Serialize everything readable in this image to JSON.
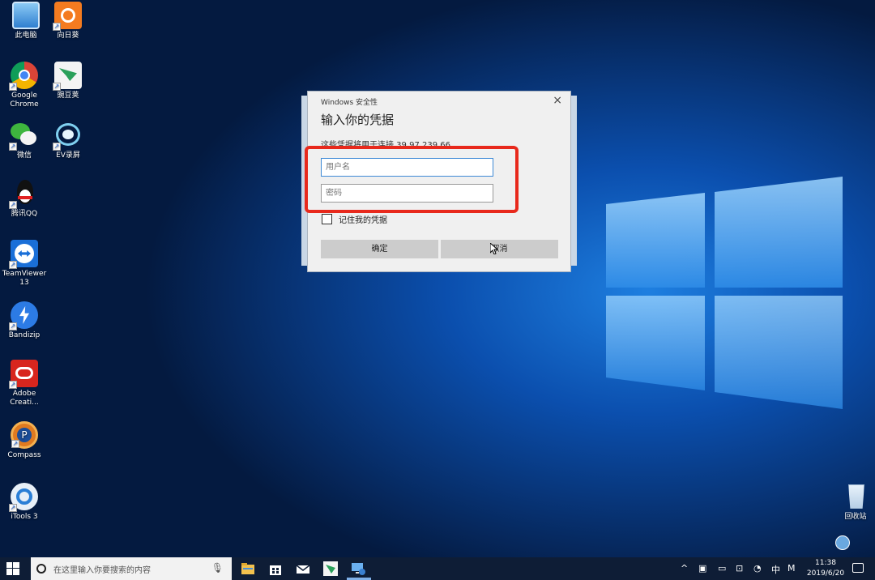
{
  "desktop": {
    "icons": [
      {
        "label": "此电脑"
      },
      {
        "label": "向日葵"
      },
      {
        "label": "Google Chrome"
      },
      {
        "label": "豌豆荚"
      },
      {
        "label": "微信"
      },
      {
        "label": "EV录屏"
      },
      {
        "label": "腾讯QQ"
      },
      {
        "label": "TeamViewer 13"
      },
      {
        "label": "Bandizip"
      },
      {
        "label": "Adobe Creati..."
      },
      {
        "label": "Compass"
      },
      {
        "label": "iTools 3"
      }
    ],
    "recycle_bin": "回收站"
  },
  "dialog": {
    "title": "Windows 安全性",
    "heading": "输入你的凭据",
    "description": "这些凭据将用于连接 39.97.239.66",
    "username_placeholder": "用户名",
    "password_placeholder": "密码",
    "remember_label": "记住我的凭据",
    "ok_label": "确定",
    "cancel_label": "取消",
    "close_glyph": "×"
  },
  "taskbar": {
    "search_placeholder": "在这里输入你要搜索的内容",
    "ime": "中",
    "ime_mode": "M",
    "time": "11:38",
    "date": "2019/6/20"
  },
  "colors": {
    "highlight": "#e8291c",
    "taskbar": "#0e1d36"
  }
}
